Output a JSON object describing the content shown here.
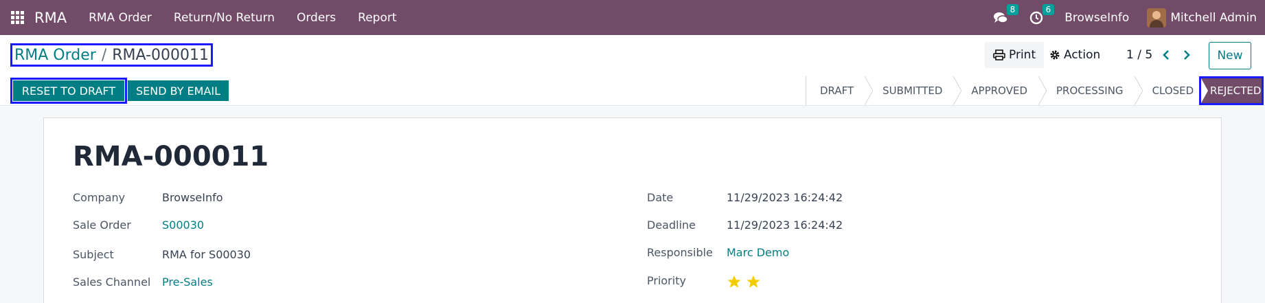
{
  "navbar": {
    "app_name": "RMA",
    "menu": [
      "RMA Order",
      "Return/No Return",
      "Orders",
      "Report"
    ],
    "messages_count": "8",
    "activities_count": "6",
    "company": "BrowseInfo",
    "user": "Mitchell Admin"
  },
  "control": {
    "breadcrumb": {
      "parent": "RMA Order",
      "separator": "/",
      "current": "RMA-000011"
    },
    "print_label": "Print",
    "action_label": "Action",
    "pager": "1 / 5",
    "new_label": "New",
    "reset_label": "RESET TO DRAFT",
    "email_label": "SEND BY EMAIL",
    "status_steps": [
      "DRAFT",
      "SUBMITTED",
      "APPROVED",
      "PROCESSING",
      "CLOSED"
    ],
    "status_active": "REJECTED"
  },
  "form": {
    "title": "RMA-000011",
    "left": {
      "company": {
        "label": "Company",
        "value": "BrowseInfo"
      },
      "sale_order": {
        "label": "Sale Order",
        "value": "S00030"
      },
      "subject": {
        "label": "Subject",
        "value": "RMA for S00030"
      },
      "sales_channel": {
        "label": "Sales Channel",
        "value": "Pre-Sales"
      }
    },
    "right": {
      "date": {
        "label": "Date",
        "value": "11/29/2023 16:24:42"
      },
      "deadline": {
        "label": "Deadline",
        "value": "11/29/2023 16:24:42"
      },
      "responsible": {
        "label": "Responsible",
        "value": "Marc Demo"
      },
      "priority": {
        "label": "Priority",
        "stars": 2
      }
    }
  },
  "colors": {
    "brand": "#714b67",
    "accent": "#017e84",
    "star": "#f3cc00",
    "highlight": "#1a1aff"
  }
}
